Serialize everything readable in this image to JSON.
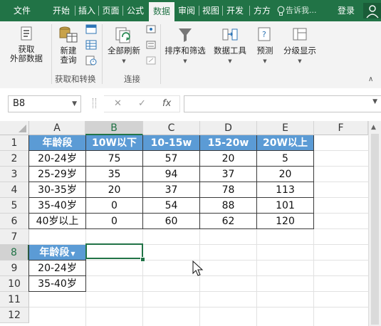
{
  "menu": {
    "tabs": [
      "文件",
      "开始",
      "插入",
      "页面",
      "公式",
      "数据",
      "审阅",
      "视图",
      "开发",
      "方方"
    ],
    "active_index": 5,
    "tell_me": "告诉我...",
    "login": "登录"
  },
  "ribbon": {
    "get_data_label": "获取\n外部数据",
    "new_query_label": "新建\n查询",
    "refresh_all_label": "全部刷新",
    "sort_filter_label": "排序和筛选",
    "data_tools_label": "数据工具",
    "forecast_label": "预测",
    "outline_label": "分级显示",
    "group_get_transform": "获取和转换",
    "group_connections": "连接"
  },
  "formula_bar": {
    "name_box": "B8",
    "cancel": "✕",
    "enter": "✓",
    "fx": "fx",
    "content": ""
  },
  "sheet": {
    "columns": [
      "A",
      "B",
      "C",
      "D",
      "E",
      "F"
    ],
    "rows": [
      "1",
      "2",
      "3",
      "4",
      "5",
      "6",
      "7",
      "8",
      "9",
      "10",
      "11",
      "12"
    ],
    "selected_column": "B",
    "selected_row": "8",
    "header_row": [
      "年龄段",
      "10W以下",
      "10-15w",
      "15-20w",
      "20W以上"
    ],
    "data_rows": [
      [
        "20-24岁",
        "75",
        "57",
        "20",
        "5"
      ],
      [
        "25-29岁",
        "35",
        "94",
        "37",
        "20"
      ],
      [
        "30-35岁",
        "20",
        "37",
        "78",
        "113"
      ],
      [
        "35-40岁",
        "0",
        "54",
        "88",
        "101"
      ],
      [
        "40岁以上",
        "0",
        "60",
        "62",
        "120"
      ]
    ],
    "filter_header": "年龄段",
    "filter_rows": [
      "20-24岁",
      "35-40岁"
    ],
    "header_color": "#5b9bd5",
    "accent_color": "#217346"
  }
}
